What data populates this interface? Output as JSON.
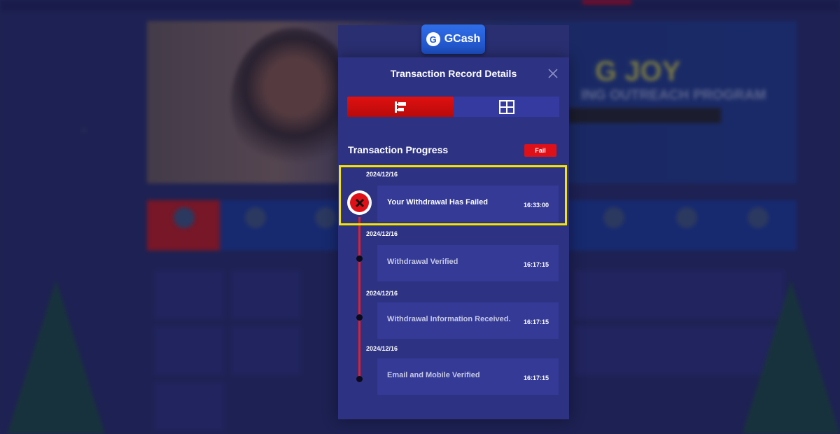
{
  "logo": {
    "name": "GCash",
    "icon_letter": "G",
    "icon": "gcash-logo-icon"
  },
  "modal": {
    "title": "Transaction Record Details",
    "close_icon": "close-icon",
    "tabs": [
      {
        "name": "progress-tab",
        "icon": "timeline-icon",
        "active": true
      },
      {
        "name": "table-tab",
        "icon": "grid-table-icon",
        "active": false
      }
    ],
    "section_title": "Transaction Progress",
    "status_badge": "Fail",
    "steps": [
      {
        "date": "2024/12/16",
        "label": "Your Withdrawal Has Failed",
        "time": "16:33:00",
        "status": "failed"
      },
      {
        "date": "2024/12/16",
        "label": "Withdrawal  Verified",
        "time": "16:17:15",
        "status": "done"
      },
      {
        "date": "2024/12/16",
        "label": "Withdrawal Information Received.",
        "time": "16:17:15",
        "status": "done"
      },
      {
        "date": "2024/12/16",
        "label": "Email and Mobile Verified",
        "time": "16:17:15",
        "status": "done"
      }
    ]
  },
  "colors": {
    "accent_red": "#e01018",
    "highlight_yellow": "#f5e400",
    "modal_bg": "#2d3283",
    "card_bg": "#343a95",
    "gcash_blue": "#1f5ad6"
  }
}
